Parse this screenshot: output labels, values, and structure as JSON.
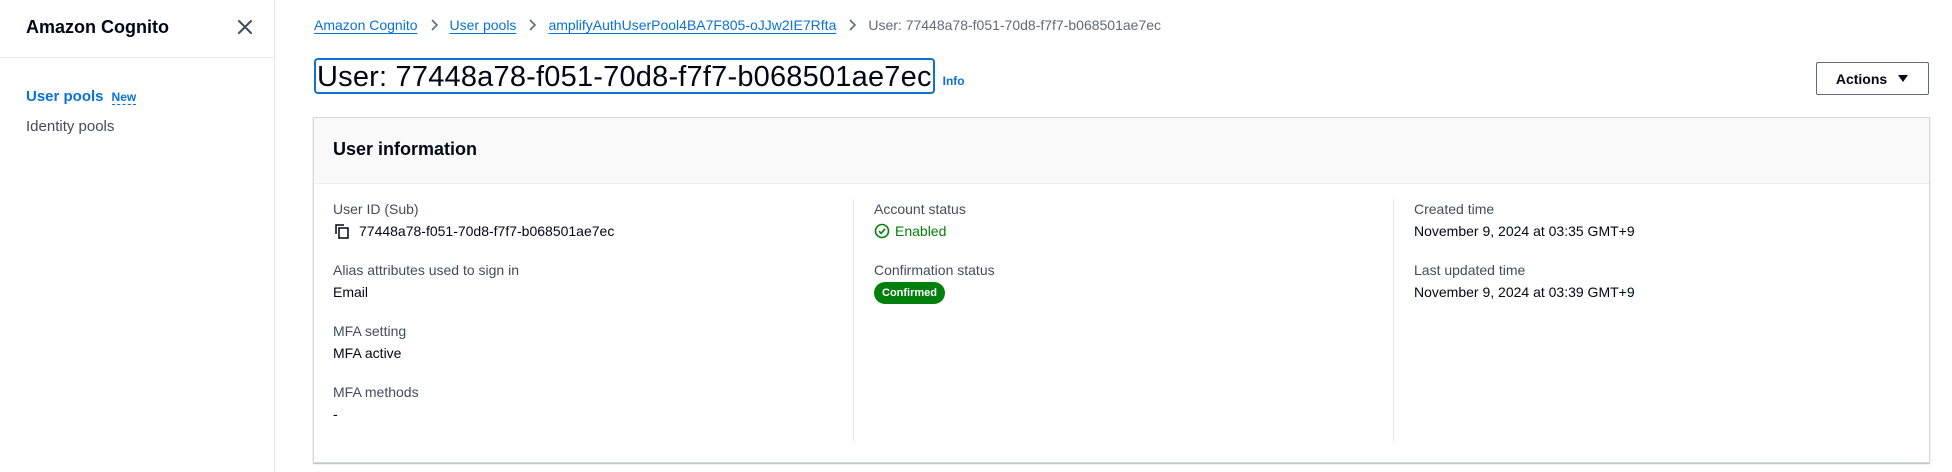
{
  "sidebar": {
    "title": "Amazon Cognito",
    "items": [
      {
        "label": "User pools",
        "badge": "New"
      },
      {
        "label": "Identity pools"
      }
    ]
  },
  "breadcrumbs": [
    {
      "label": "Amazon Cognito"
    },
    {
      "label": "User pools"
    },
    {
      "label": "amplifyAuthUserPool4BA7F805-oJJw2IE7Rfta"
    },
    {
      "label": "User: 77448a78-f051-70d8-f7f7-b068501ae7ec"
    }
  ],
  "page": {
    "title": "User: 77448a78-f051-70d8-f7f7-b068501ae7ec",
    "info_label": "Info",
    "actions_label": "Actions"
  },
  "user_info": {
    "title": "User information",
    "user_id_label": "User ID (Sub)",
    "user_id_value": "77448a78-f051-70d8-f7f7-b068501ae7ec",
    "alias_label": "Alias attributes used to sign in",
    "alias_value": "Email",
    "mfa_setting_label": "MFA setting",
    "mfa_setting_value": "MFA active",
    "mfa_methods_label": "MFA methods",
    "mfa_methods_value": "-",
    "account_status_label": "Account status",
    "account_status_value": "Enabled",
    "confirmation_status_label": "Confirmation status",
    "confirmation_status_value": "Confirmed",
    "created_label": "Created time",
    "created_value": "November 9, 2024 at 03:35 GMT+9",
    "updated_label": "Last updated time",
    "updated_value": "November 9, 2024 at 03:39 GMT+9"
  },
  "icons": {
    "close": "close-icon",
    "breadcrumb_separator": "chevron-right-icon",
    "caret": "caret-down-icon",
    "copy": "copy-icon",
    "status": "check-circle-icon"
  },
  "colors": {
    "link": "#0972d3",
    "success": "#037f0c",
    "text": "#000716",
    "muted": "#414d5c"
  }
}
